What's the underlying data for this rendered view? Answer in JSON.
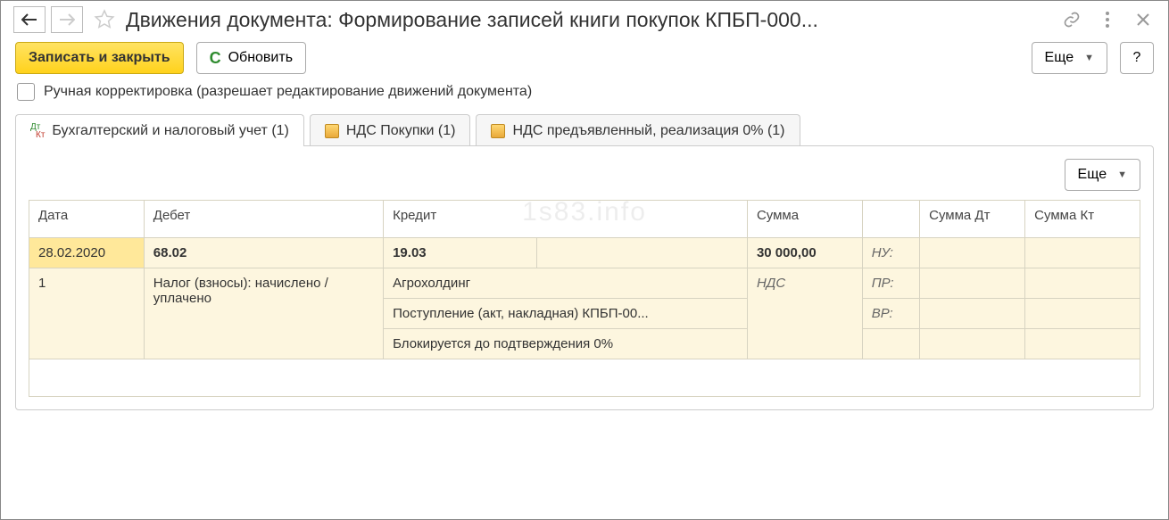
{
  "title": "Движения документа: Формирование записей книги покупок КПБП-000...",
  "toolbar": {
    "save_close": "Записать и закрыть",
    "refresh": "Обновить",
    "more": "Еще",
    "help": "?"
  },
  "manual_edit_label": "Ручная корректировка (разрешает редактирование движений документа)",
  "tabs": [
    {
      "label": "Бухгалтерский и налоговый учет (1)"
    },
    {
      "label": "НДС Покупки (1)"
    },
    {
      "label": "НДС предъявленный, реализация 0% (1)"
    }
  ],
  "panel": {
    "more": "Еще"
  },
  "table": {
    "headers": {
      "date": "Дата",
      "debit": "Дебет",
      "credit": "Кредит",
      "sum": "Сумма",
      "blank": "",
      "sum_dt": "Сумма Дт",
      "sum_kt": "Сумма Кт"
    },
    "row1": {
      "date": "28.02.2020",
      "debit": "68.02",
      "credit": "19.03",
      "sum": "30 000,00",
      "tag": "НУ:"
    },
    "row2": {
      "num": "1",
      "debit": "Налог (взносы): начислено / уплачено",
      "credit": "Агрохолдинг",
      "sum": "НДС",
      "tag": "ПР:"
    },
    "row3": {
      "credit": "Поступление (акт, накладная) КПБП-00...",
      "tag": "ВР:"
    },
    "row4": {
      "credit": "Блокируется до подтверждения 0%"
    }
  },
  "watermark": "1s83.info"
}
